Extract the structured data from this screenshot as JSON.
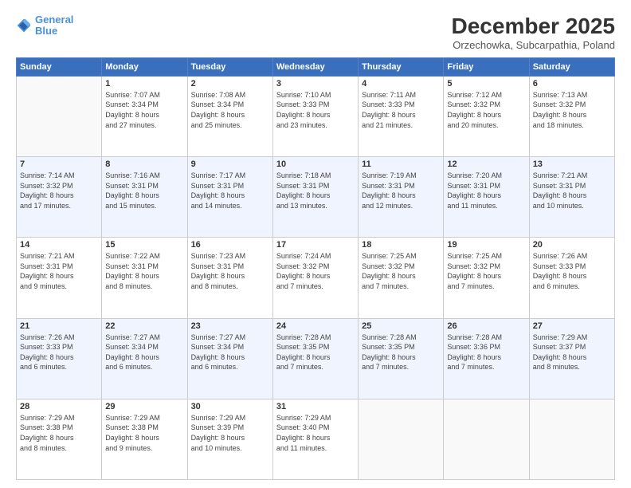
{
  "header": {
    "logo_line1": "General",
    "logo_line2": "Blue",
    "title": "December 2025",
    "subtitle": "Orzechowka, Subcarpathia, Poland"
  },
  "weekdays": [
    "Sunday",
    "Monday",
    "Tuesday",
    "Wednesday",
    "Thursday",
    "Friday",
    "Saturday"
  ],
  "weeks": [
    [
      {
        "day": "",
        "sunrise": "",
        "sunset": "",
        "daylight": ""
      },
      {
        "day": "1",
        "sunrise": "Sunrise: 7:07 AM",
        "sunset": "Sunset: 3:34 PM",
        "daylight": "Daylight: 8 hours and 27 minutes."
      },
      {
        "day": "2",
        "sunrise": "Sunrise: 7:08 AM",
        "sunset": "Sunset: 3:34 PM",
        "daylight": "Daylight: 8 hours and 25 minutes."
      },
      {
        "day": "3",
        "sunrise": "Sunrise: 7:10 AM",
        "sunset": "Sunset: 3:33 PM",
        "daylight": "Daylight: 8 hours and 23 minutes."
      },
      {
        "day": "4",
        "sunrise": "Sunrise: 7:11 AM",
        "sunset": "Sunset: 3:33 PM",
        "daylight": "Daylight: 8 hours and 21 minutes."
      },
      {
        "day": "5",
        "sunrise": "Sunrise: 7:12 AM",
        "sunset": "Sunset: 3:32 PM",
        "daylight": "Daylight: 8 hours and 20 minutes."
      },
      {
        "day": "6",
        "sunrise": "Sunrise: 7:13 AM",
        "sunset": "Sunset: 3:32 PM",
        "daylight": "Daylight: 8 hours and 18 minutes."
      }
    ],
    [
      {
        "day": "7",
        "sunrise": "Sunrise: 7:14 AM",
        "sunset": "Sunset: 3:32 PM",
        "daylight": "Daylight: 8 hours and 17 minutes."
      },
      {
        "day": "8",
        "sunrise": "Sunrise: 7:16 AM",
        "sunset": "Sunset: 3:31 PM",
        "daylight": "Daylight: 8 hours and 15 minutes."
      },
      {
        "day": "9",
        "sunrise": "Sunrise: 7:17 AM",
        "sunset": "Sunset: 3:31 PM",
        "daylight": "Daylight: 8 hours and 14 minutes."
      },
      {
        "day": "10",
        "sunrise": "Sunrise: 7:18 AM",
        "sunset": "Sunset: 3:31 PM",
        "daylight": "Daylight: 8 hours and 13 minutes."
      },
      {
        "day": "11",
        "sunrise": "Sunrise: 7:19 AM",
        "sunset": "Sunset: 3:31 PM",
        "daylight": "Daylight: 8 hours and 12 minutes."
      },
      {
        "day": "12",
        "sunrise": "Sunrise: 7:20 AM",
        "sunset": "Sunset: 3:31 PM",
        "daylight": "Daylight: 8 hours and 11 minutes."
      },
      {
        "day": "13",
        "sunrise": "Sunrise: 7:21 AM",
        "sunset": "Sunset: 3:31 PM",
        "daylight": "Daylight: 8 hours and 10 minutes."
      }
    ],
    [
      {
        "day": "14",
        "sunrise": "Sunrise: 7:21 AM",
        "sunset": "Sunset: 3:31 PM",
        "daylight": "Daylight: 8 hours and 9 minutes."
      },
      {
        "day": "15",
        "sunrise": "Sunrise: 7:22 AM",
        "sunset": "Sunset: 3:31 PM",
        "daylight": "Daylight: 8 hours and 8 minutes."
      },
      {
        "day": "16",
        "sunrise": "Sunrise: 7:23 AM",
        "sunset": "Sunset: 3:31 PM",
        "daylight": "Daylight: 8 hours and 8 minutes."
      },
      {
        "day": "17",
        "sunrise": "Sunrise: 7:24 AM",
        "sunset": "Sunset: 3:32 PM",
        "daylight": "Daylight: 8 hours and 7 minutes."
      },
      {
        "day": "18",
        "sunrise": "Sunrise: 7:25 AM",
        "sunset": "Sunset: 3:32 PM",
        "daylight": "Daylight: 8 hours and 7 minutes."
      },
      {
        "day": "19",
        "sunrise": "Sunrise: 7:25 AM",
        "sunset": "Sunset: 3:32 PM",
        "daylight": "Daylight: 8 hours and 7 minutes."
      },
      {
        "day": "20",
        "sunrise": "Sunrise: 7:26 AM",
        "sunset": "Sunset: 3:33 PM",
        "daylight": "Daylight: 8 hours and 6 minutes."
      }
    ],
    [
      {
        "day": "21",
        "sunrise": "Sunrise: 7:26 AM",
        "sunset": "Sunset: 3:33 PM",
        "daylight": "Daylight: 8 hours and 6 minutes."
      },
      {
        "day": "22",
        "sunrise": "Sunrise: 7:27 AM",
        "sunset": "Sunset: 3:34 PM",
        "daylight": "Daylight: 8 hours and 6 minutes."
      },
      {
        "day": "23",
        "sunrise": "Sunrise: 7:27 AM",
        "sunset": "Sunset: 3:34 PM",
        "daylight": "Daylight: 8 hours and 6 minutes."
      },
      {
        "day": "24",
        "sunrise": "Sunrise: 7:28 AM",
        "sunset": "Sunset: 3:35 PM",
        "daylight": "Daylight: 8 hours and 7 minutes."
      },
      {
        "day": "25",
        "sunrise": "Sunrise: 7:28 AM",
        "sunset": "Sunset: 3:35 PM",
        "daylight": "Daylight: 8 hours and 7 minutes."
      },
      {
        "day": "26",
        "sunrise": "Sunrise: 7:28 AM",
        "sunset": "Sunset: 3:36 PM",
        "daylight": "Daylight: 8 hours and 7 minutes."
      },
      {
        "day": "27",
        "sunrise": "Sunrise: 7:29 AM",
        "sunset": "Sunset: 3:37 PM",
        "daylight": "Daylight: 8 hours and 8 minutes."
      }
    ],
    [
      {
        "day": "28",
        "sunrise": "Sunrise: 7:29 AM",
        "sunset": "Sunset: 3:38 PM",
        "daylight": "Daylight: 8 hours and 8 minutes."
      },
      {
        "day": "29",
        "sunrise": "Sunrise: 7:29 AM",
        "sunset": "Sunset: 3:38 PM",
        "daylight": "Daylight: 8 hours and 9 minutes."
      },
      {
        "day": "30",
        "sunrise": "Sunrise: 7:29 AM",
        "sunset": "Sunset: 3:39 PM",
        "daylight": "Daylight: 8 hours and 10 minutes."
      },
      {
        "day": "31",
        "sunrise": "Sunrise: 7:29 AM",
        "sunset": "Sunset: 3:40 PM",
        "daylight": "Daylight: 8 hours and 11 minutes."
      },
      {
        "day": "",
        "sunrise": "",
        "sunset": "",
        "daylight": ""
      },
      {
        "day": "",
        "sunrise": "",
        "sunset": "",
        "daylight": ""
      },
      {
        "day": "",
        "sunrise": "",
        "sunset": "",
        "daylight": ""
      }
    ]
  ]
}
